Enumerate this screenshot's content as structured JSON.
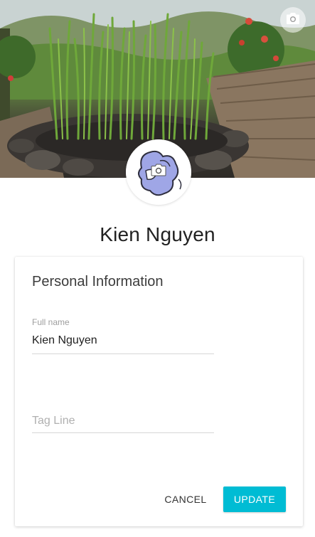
{
  "cover": {
    "image": "rice-seedlings-tray-photo",
    "change_cover_icon": "camera-icon"
  },
  "avatar": {
    "image": "illustrated-avatar",
    "change_avatar_icon": "camera-icon"
  },
  "profile": {
    "name": "Kien Nguyen"
  },
  "personal_info": {
    "title": "Personal Information",
    "full_name": {
      "label": "Full name",
      "value": "Kien Nguyen"
    },
    "tag_line": {
      "placeholder": "Tag Line",
      "value": ""
    }
  },
  "actions": {
    "cancel_label": "CANCEL",
    "update_label": "UPDATE"
  },
  "colors": {
    "accent": "#00bcd4",
    "text": "#212121",
    "muted": "#9e9e9e"
  }
}
